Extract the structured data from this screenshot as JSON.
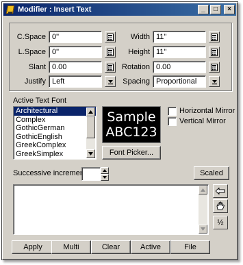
{
  "window": {
    "title": "Modifier : Insert Text"
  },
  "titlebar": {
    "minimize": "_",
    "maximize": "□",
    "close": "×"
  },
  "params": {
    "cspace": {
      "label": "C.Space",
      "value": "0\""
    },
    "lspace": {
      "label": "L.Space",
      "value": "0\""
    },
    "slant": {
      "label": "Slant",
      "value": "0.00"
    },
    "justify": {
      "label": "Justify",
      "value": "Left"
    },
    "width": {
      "label": "Width",
      "value": "11\""
    },
    "height": {
      "label": "Height",
      "value": "11\""
    },
    "rotation": {
      "label": "Rotation",
      "value": "0.00"
    },
    "spacing": {
      "label": "Spacing",
      "value": "Proportional"
    }
  },
  "font": {
    "section_label": "Active Text Font",
    "items": [
      "Architectural",
      "Complex",
      "GothicGerman",
      "GothicEnglish",
      "GreekComplex",
      "GreekSimplex"
    ],
    "selected": "Architectural",
    "preview_line1": "Sample",
    "preview_line2": "ABC123",
    "picker_label": "Font Picker...",
    "horizontal_mirror": "Horizontal Mirror",
    "vertical_mirror": "Vertical Mirror"
  },
  "increment": {
    "label": "Successive increment",
    "value": "",
    "scaled_label": "Scaled"
  },
  "text_input": {
    "value": ""
  },
  "side_buttons": {
    "half_label": "½"
  },
  "bottom": {
    "apply": "Apply",
    "multi": "Multi",
    "clear": "Clear",
    "active": "Active",
    "file": "File"
  },
  "icons": {
    "calculator": "calculator-icon",
    "dropdown": "chevron-down-icon",
    "backspace": "arrow-left-icon",
    "hand": "hand-icon"
  }
}
